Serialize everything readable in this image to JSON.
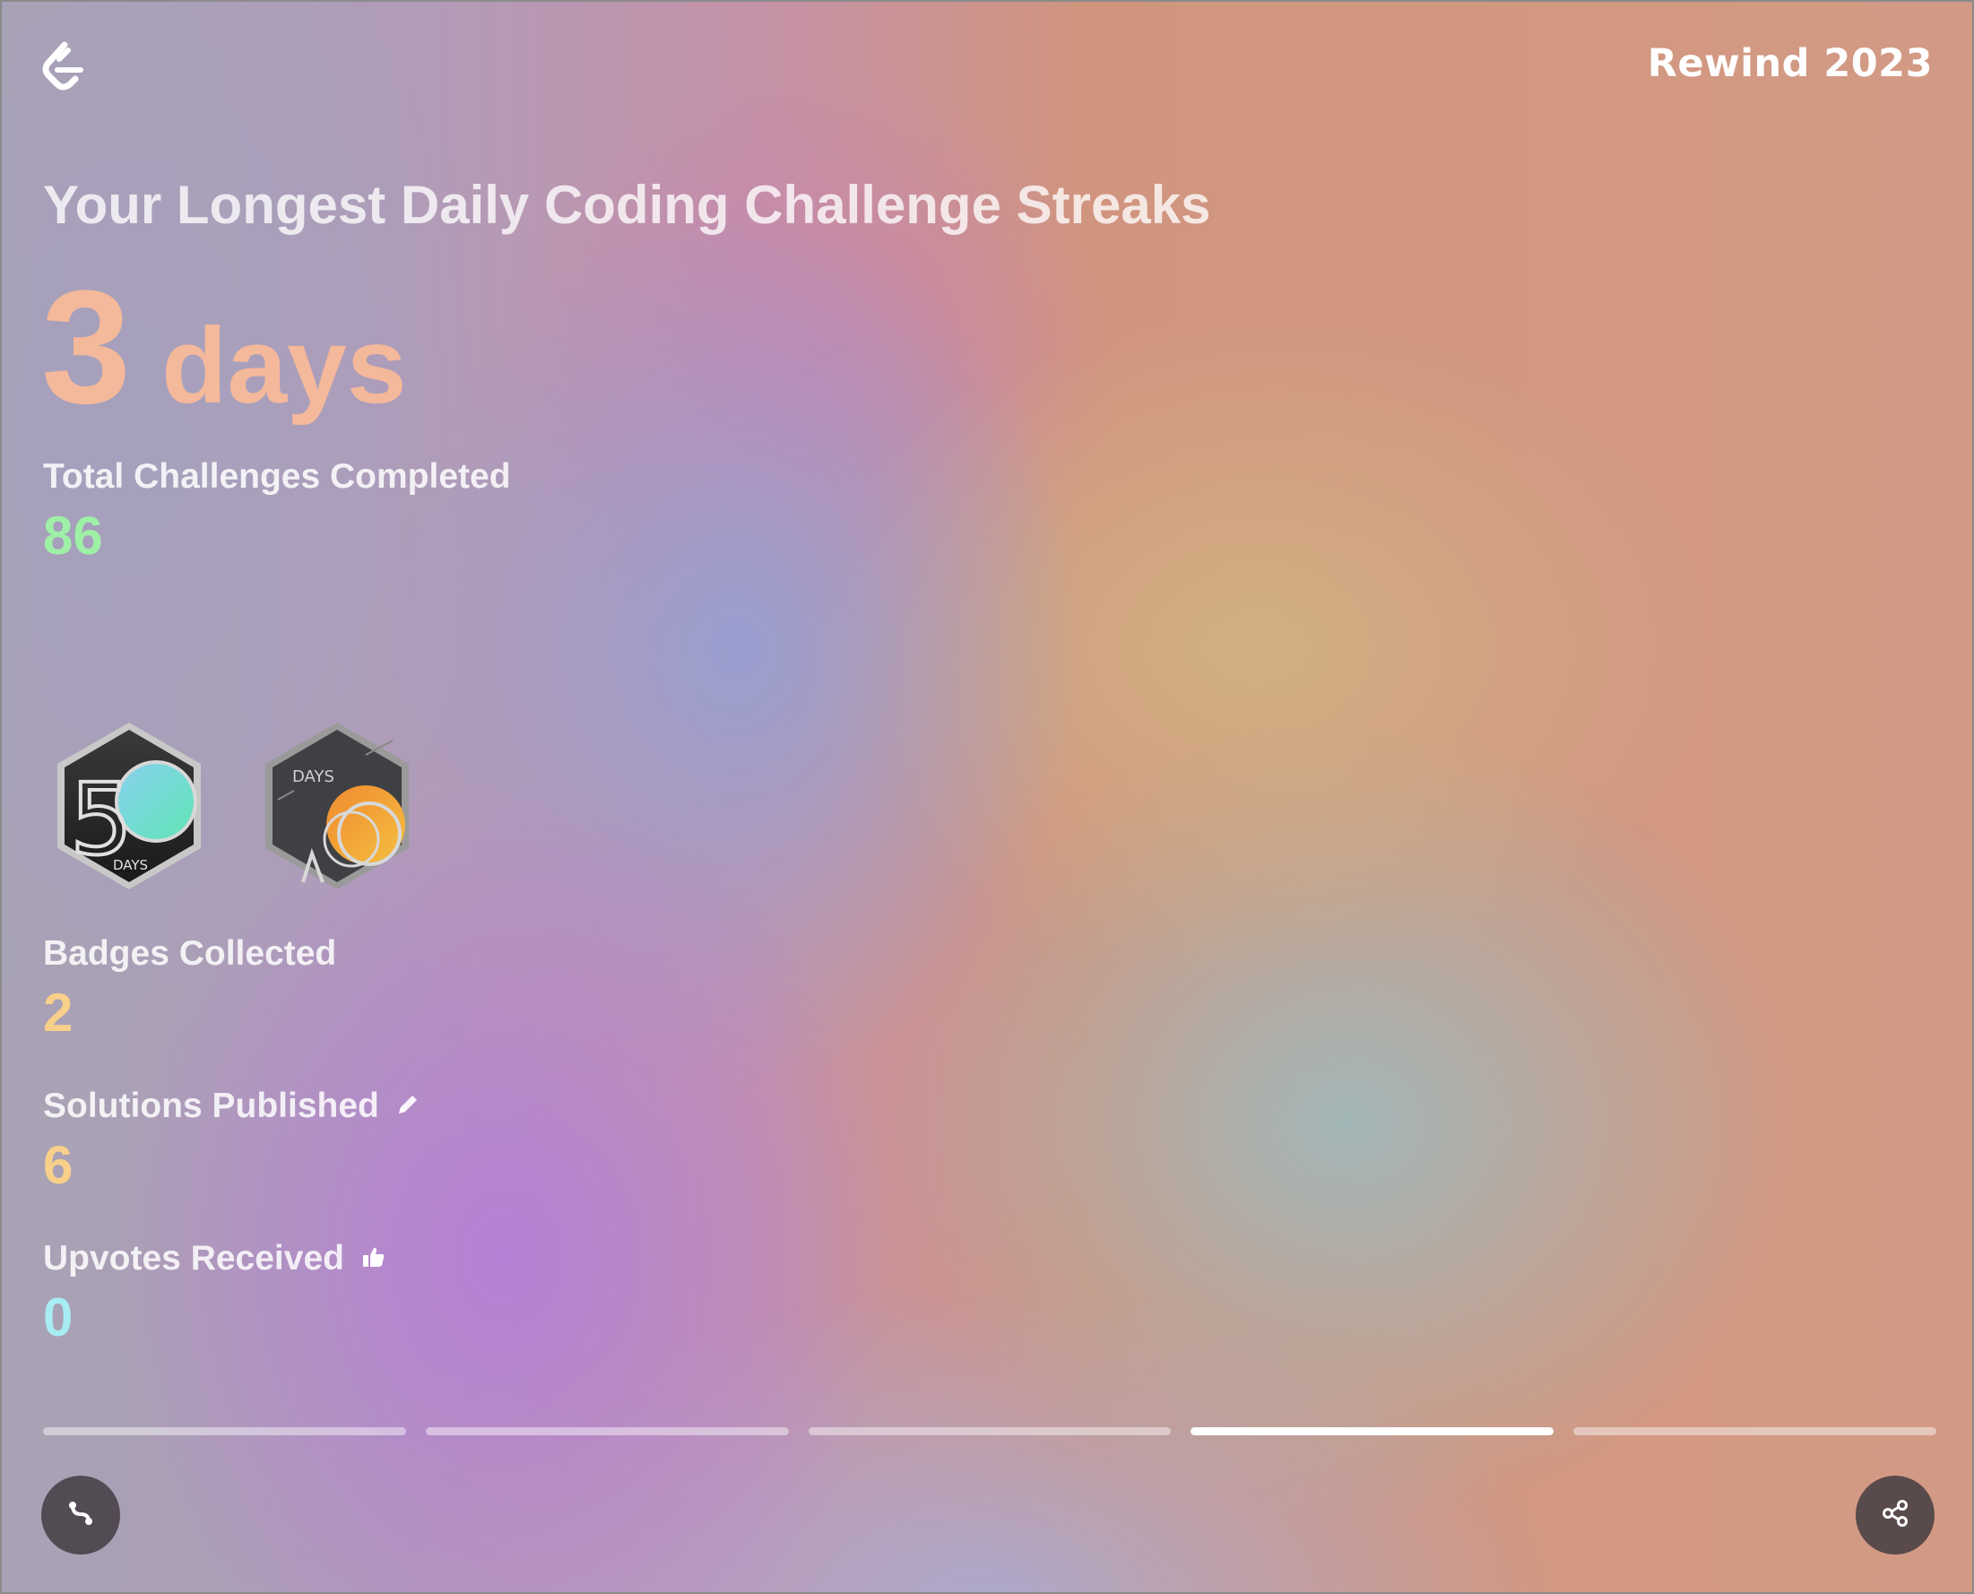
{
  "header": {
    "logo_icon": "leetcode-logo-icon",
    "brand_title": "Rewind 2023"
  },
  "headline": "Your Longest Daily Coding Challenge Streaks",
  "streak": {
    "value": "3",
    "unit": "days",
    "color": "#f4b89a"
  },
  "stats": {
    "total_challenges": {
      "label": "Total Challenges Completed",
      "value": "86",
      "color": "#9ef0a6"
    },
    "badges": {
      "label": "Badges Collected",
      "value": "2",
      "color": "#f8d08a",
      "items": [
        {
          "icon": "50-days-badge-icon",
          "big_text": "5",
          "small_text": "DAYS"
        },
        {
          "icon": "100-days-badge-icon",
          "big_text": "1",
          "small_text": "DAYS"
        }
      ]
    },
    "solutions": {
      "label": "Solutions Published",
      "icon": "pencil-icon",
      "value": "6",
      "color": "#f8d08a"
    },
    "upvotes": {
      "label": "Upvotes Received",
      "icon": "thumbs-up-icon",
      "value": "0",
      "color": "#a8ecf4"
    }
  },
  "progress": {
    "segments": 5,
    "active_index": 3
  },
  "buttons": {
    "left_icon": "path-icon",
    "right_icon": "share-icon"
  }
}
